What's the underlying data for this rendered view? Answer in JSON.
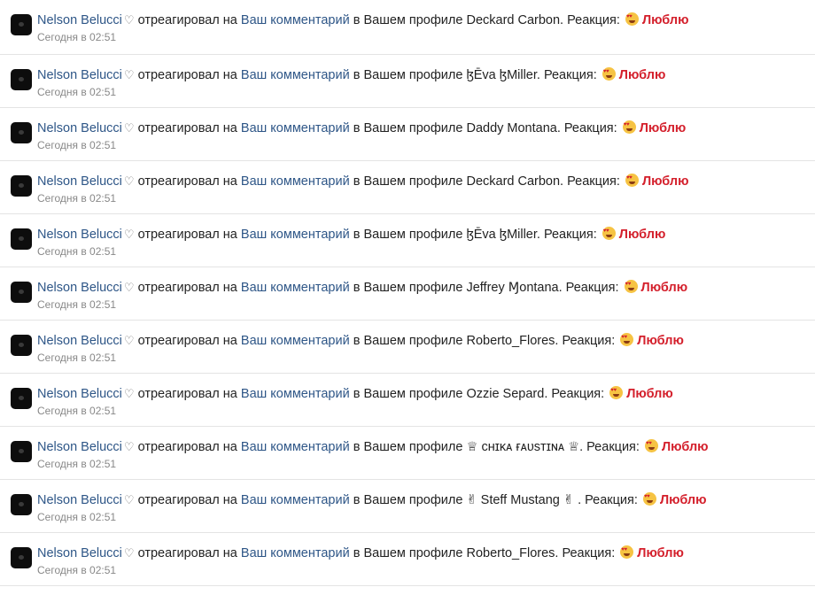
{
  "notifications": [
    {
      "user": "Nelson Belucci",
      "heart": "♡",
      "action": "отреагировал на",
      "link": "Ваш комментарий",
      "context": "в Вашем профиле",
      "profile": "Deckard Carbon",
      "reaction_prefix": ". Реакция:",
      "reaction": "Люблю",
      "time": "Сегодня в 02:51"
    },
    {
      "user": "Nelson Belucci",
      "heart": "♡",
      "action": "отреагировал на",
      "link": "Ваш комментарий",
      "context": "в Вашем профиле",
      "profile": "ɮĒva ɮMiller",
      "reaction_prefix": ". Реакция:",
      "reaction": "Люблю",
      "time": "Сегодня в 02:51"
    },
    {
      "user": "Nelson Belucci",
      "heart": "♡",
      "action": "отреагировал на",
      "link": "Ваш комментарий",
      "context": "в Вашем профиле",
      "profile": "Daddy Montana",
      "reaction_prefix": ". Реакция:",
      "reaction": "Люблю",
      "time": "Сегодня в 02:51"
    },
    {
      "user": "Nelson Belucci",
      "heart": "♡",
      "action": "отреагировал на",
      "link": "Ваш комментарий",
      "context": "в Вашем профиле",
      "profile": "Deckard Carbon",
      "reaction_prefix": ". Реакция:",
      "reaction": "Люблю",
      "time": "Сегодня в 02:51"
    },
    {
      "user": "Nelson Belucci",
      "heart": "♡",
      "action": "отреагировал на",
      "link": "Ваш комментарий",
      "context": "в Вашем профиле",
      "profile": "ɮĒva ɮMiller",
      "reaction_prefix": ". Реакция:",
      "reaction": "Люблю",
      "time": "Сегодня в 02:51"
    },
    {
      "user": "Nelson Belucci",
      "heart": "♡",
      "action": "отреагировал на",
      "link": "Ваш комментарий",
      "context": "в Вашем профиле",
      "profile": "Jeffrey Ɱontana",
      "reaction_prefix": ". Реакция:",
      "reaction": "Люблю",
      "time": "Сегодня в 02:51"
    },
    {
      "user": "Nelson Belucci",
      "heart": "♡",
      "action": "отреагировал на",
      "link": "Ваш комментарий",
      "context": "в Вашем профиле",
      "profile": "Roberto_Flores",
      "reaction_prefix": ". Реакция:",
      "reaction": "Люблю",
      "time": "Сегодня в 02:51"
    },
    {
      "user": "Nelson Belucci",
      "heart": "♡",
      "action": "отреагировал на",
      "link": "Ваш комментарий",
      "context": "в Вашем профиле",
      "profile": "Ozzie Separd",
      "reaction_prefix": ". Реакция:",
      "reaction": "Люблю",
      "time": "Сегодня в 02:51"
    },
    {
      "user": "Nelson Belucci",
      "heart": "♡",
      "action": "отреагировал на",
      "link": "Ваш комментарий",
      "context": "в Вашем профиле",
      "profile": "♕ ᴄʜɪᴋᴀ ғᴀᴜsᴛɪɴᴀ ♕",
      "reaction_prefix": ". Реакция:",
      "reaction": "Люблю",
      "time": "Сегодня в 02:51"
    },
    {
      "user": "Nelson Belucci",
      "heart": "♡",
      "action": "отреагировал на",
      "link": "Ваш комментарий",
      "context": "в Вашем профиле",
      "profile": "✌ Steff Mustang ✌ ",
      "reaction_prefix": ". Реакция:",
      "reaction": "Люблю",
      "time": "Сегодня в 02:51"
    },
    {
      "user": "Nelson Belucci",
      "heart": "♡",
      "action": "отреагировал на",
      "link": "Ваш комментарий",
      "context": "в Вашем профиле",
      "profile": "Roberto_Flores",
      "reaction_prefix": ". Реакция:",
      "reaction": "Люблю",
      "time": "Сегодня в 02:51"
    }
  ],
  "colors": {
    "link": "#2e5687",
    "reaction": "#d4202c",
    "muted": "#888888",
    "divider": "#e4e4e4"
  },
  "icons": {
    "avatar": "user-avatar",
    "reaction_emoji": "heart-eyes-emoji"
  }
}
